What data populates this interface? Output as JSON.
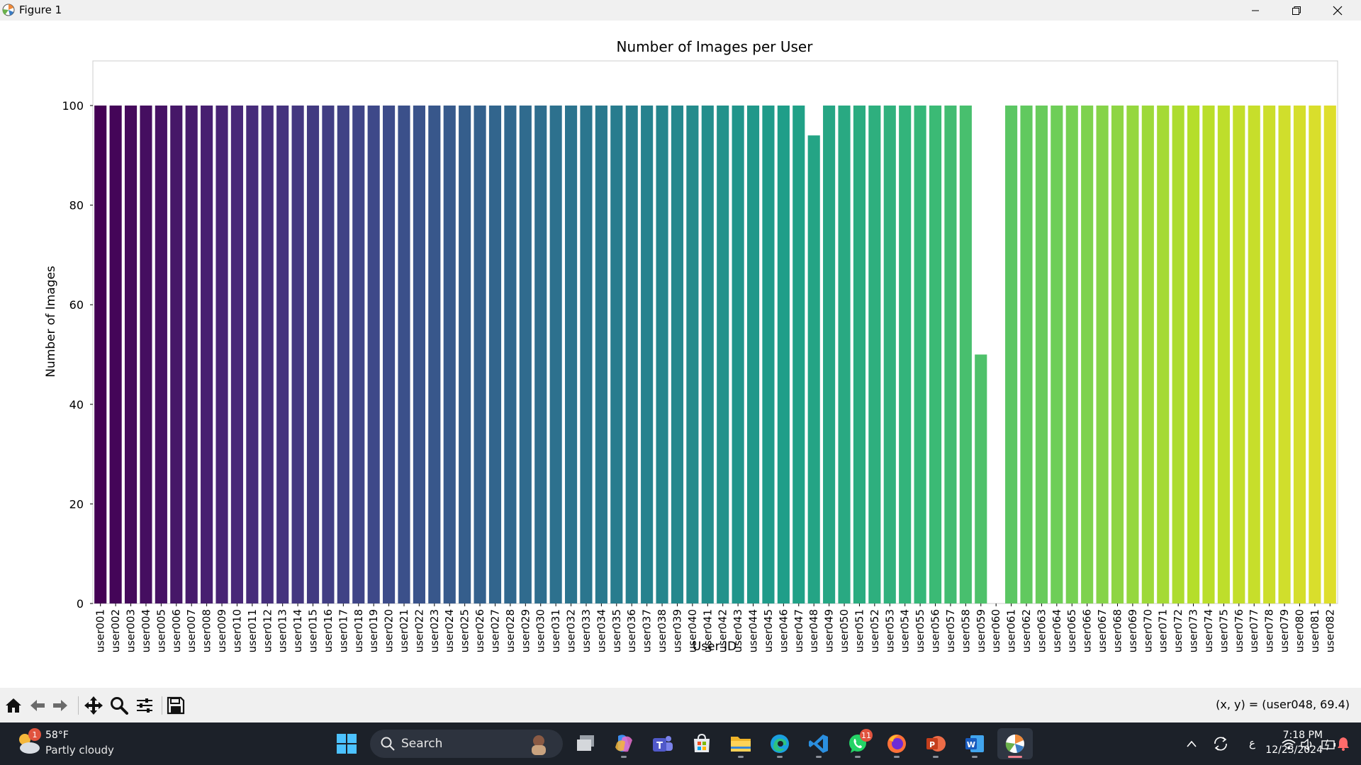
{
  "window": {
    "title": "Figure 1",
    "icon": "matplotlib-icon"
  },
  "chart_data": {
    "type": "bar",
    "title": "Number of Images per User",
    "xlabel": "User ID",
    "ylabel": "Number of Images",
    "ylim": [
      0,
      105
    ],
    "yticks": [
      0,
      20,
      40,
      60,
      80,
      100
    ],
    "grid": false,
    "colormap": "viridis",
    "colors": {
      "start": "#440154",
      "mid": "#21918c",
      "end": "#dede2c"
    },
    "categories": [
      "user001",
      "user002",
      "user003",
      "user004",
      "user005",
      "user006",
      "user007",
      "user008",
      "user009",
      "user010",
      "user011",
      "user012",
      "user013",
      "user014",
      "user015",
      "user016",
      "user017",
      "user018",
      "user019",
      "user020",
      "user021",
      "user022",
      "user023",
      "user024",
      "user025",
      "user026",
      "user027",
      "user028",
      "user029",
      "user030",
      "user031",
      "user032",
      "user033",
      "user034",
      "user035",
      "user036",
      "user037",
      "user038",
      "user039",
      "user040",
      "user041",
      "user042",
      "user043",
      "user044",
      "user045",
      "user046",
      "user047",
      "user048",
      "user049",
      "user050",
      "user051",
      "user052",
      "user053",
      "user054",
      "user055",
      "user056",
      "user057",
      "user058",
      "user059",
      "user060",
      "user061",
      "user062",
      "user063",
      "user064",
      "user065",
      "user066",
      "user067",
      "user068",
      "user069",
      "user070",
      "user071",
      "user072",
      "user073",
      "user074",
      "user075",
      "user076",
      "user077",
      "user078",
      "user079",
      "user080",
      "user081",
      "user082"
    ],
    "values": [
      100,
      100,
      100,
      100,
      100,
      100,
      100,
      100,
      100,
      100,
      100,
      100,
      100,
      100,
      100,
      100,
      100,
      100,
      100,
      100,
      100,
      100,
      100,
      100,
      100,
      100,
      100,
      100,
      100,
      100,
      100,
      100,
      100,
      100,
      100,
      100,
      100,
      100,
      100,
      100,
      100,
      100,
      100,
      100,
      100,
      100,
      100,
      94,
      100,
      100,
      100,
      100,
      100,
      100,
      100,
      100,
      100,
      100,
      50,
      0,
      100,
      100,
      100,
      100,
      100,
      100,
      100,
      100,
      100,
      100,
      100,
      100,
      100,
      100,
      100,
      100,
      100,
      100,
      100,
      100,
      100,
      100
    ]
  },
  "toolbar": {
    "buttons": [
      {
        "name": "home-icon"
      },
      {
        "name": "back-arrow-icon"
      },
      {
        "name": "forward-arrow-icon"
      },
      {
        "name": "pan-icon"
      },
      {
        "name": "zoom-icon"
      },
      {
        "name": "configure-subplots-icon"
      },
      {
        "name": "save-icon"
      }
    ],
    "coordinates": "(x, y) = (user048, 69.4)"
  },
  "taskbar": {
    "weather": {
      "temp": "58°F",
      "condition": "Partly cloudy",
      "badge": "1"
    },
    "search_label": "Search",
    "apps": [
      {
        "name": "task-view-icon"
      },
      {
        "name": "copilot-icon"
      },
      {
        "name": "teams-icon"
      },
      {
        "name": "microsoft-store-icon"
      },
      {
        "name": "file-explorer-icon"
      },
      {
        "name": "edge-icon"
      },
      {
        "name": "vscode-icon"
      },
      {
        "name": "whatsapp-icon",
        "badge": "11"
      },
      {
        "name": "firefox-icon"
      },
      {
        "name": "powerpoint-icon"
      },
      {
        "name": "word-icon"
      },
      {
        "name": "matplotlib-app-icon"
      }
    ],
    "tray_lang": "ع",
    "time": "7:18 PM",
    "date": "12/23/2024"
  }
}
